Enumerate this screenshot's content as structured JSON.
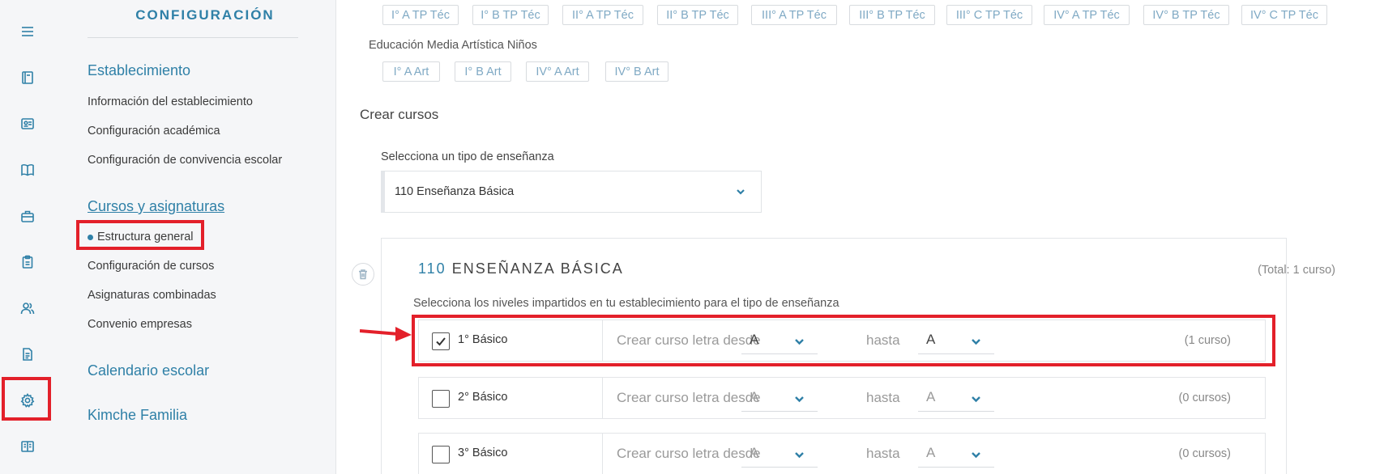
{
  "nav": {
    "title": "CONFIGURACIÓN",
    "sections": {
      "establecimiento": {
        "label": "Establecimiento",
        "items": [
          "Información del establecimiento",
          "Configuración académica",
          "Configuración de convivencia escolar"
        ]
      },
      "cursos": {
        "label": "Cursos y asignaturas",
        "active_item": "Estructura general",
        "items": [
          "Configuración de cursos",
          "Asignaturas combinadas",
          "Convenio empresas"
        ]
      },
      "calendario": {
        "label": "Calendario escolar"
      },
      "familia": {
        "label": "Kimche Familia"
      }
    }
  },
  "rail": {
    "icons": [
      "menu-icon",
      "book-icon",
      "id-card-icon",
      "open-book-icon",
      "briefcase-icon",
      "clipboard-icon",
      "users-icon",
      "document-icon",
      "gear-icon",
      "reader-icon"
    ]
  },
  "main": {
    "tp_chips": [
      "I° A TP Téc",
      "I° B TP Téc",
      "II° A TP Téc",
      "II° B TP Téc",
      "III° A TP Téc",
      "III° B TP Téc",
      "III° C TP Téc",
      "IV° A TP Téc",
      "IV° B TP Téc",
      "IV° C TP Téc"
    ],
    "art_group_label": "Educación Media Artística Niños",
    "art_chips": [
      "I° A Art",
      "I° B Art",
      "IV° A Art",
      "IV° B Art"
    ],
    "crear_title": "Crear cursos",
    "select_label": "Selecciona un tipo de enseñanza",
    "select_value": "110 Enseñanza Básica",
    "card": {
      "code": "110",
      "name": "ENSEÑANZA BÁSICA",
      "total": "(Total: 1 curso)",
      "description": "Selecciona los niveles impartidos en tu establecimiento para el tipo de enseñanza",
      "rows": [
        {
          "level": "1° Básico",
          "checked": true,
          "desde_label": "Crear curso letra desde",
          "from": "A",
          "hasta_label": "hasta",
          "to": "A",
          "count": "(1 curso)"
        },
        {
          "level": "2° Básico",
          "checked": false,
          "desde_label": "Crear curso letra desde",
          "from": "A",
          "hasta_label": "hasta",
          "to": "A",
          "count": "(0 cursos)"
        },
        {
          "level": "3° Básico",
          "checked": false,
          "desde_label": "Crear curso letra desde",
          "from": "A",
          "hasta_label": "hasta",
          "to": "A",
          "count": "(0 cursos)"
        }
      ]
    }
  },
  "colors": {
    "accent": "#2f80a7",
    "highlight": "#e3202a"
  }
}
